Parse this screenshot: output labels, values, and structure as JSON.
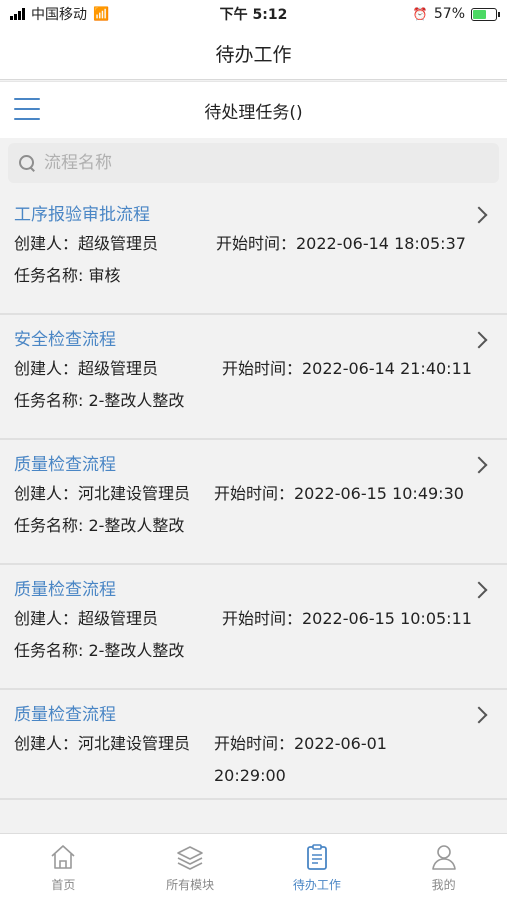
{
  "status_bar": {
    "carrier": "中国移动",
    "time": "下午 5:12",
    "battery": "57%",
    "battery_level": 0.57
  },
  "header": {
    "title": "待办工作"
  },
  "sub_header": {
    "title": "待处理任务()"
  },
  "search": {
    "placeholder": "流程名称",
    "value": ""
  },
  "tasks": [
    {
      "title": "工序报验审批流程",
      "creator": "创建人：超级管理员",
      "start": "开始时间：2022-06-14 18:05:37",
      "task": "任务名称: 审核"
    },
    {
      "title": "安全检查流程",
      "creator": "创建人：超级管理员",
      "start": "开始时间：2022-06-14 21:40:11",
      "task": "任务名称: 2-整改人整改"
    },
    {
      "title": "质量检查流程",
      "creator": "创建人：河北建设管理员",
      "start": "开始时间：2022-06-15 10:49:30",
      "task": "任务名称: 2-整改人整改"
    },
    {
      "title": "质量检查流程",
      "creator": "创建人：超级管理员",
      "start": "开始时间：2022-06-15 10:05:11",
      "task": "任务名称: 2-整改人整改"
    },
    {
      "title": "质量检查流程",
      "creator": "创建人：河北建设管理员",
      "start": "开始时间：2022-06-01 20:29:00",
      "task": ""
    }
  ],
  "tabs": [
    {
      "label": "首页",
      "icon": "home-icon",
      "active": false
    },
    {
      "label": "所有模块",
      "icon": "layers-icon",
      "active": false
    },
    {
      "label": "待办工作",
      "icon": "clipboard-icon",
      "active": true
    },
    {
      "label": "我的",
      "icon": "user-icon",
      "active": false
    }
  ],
  "colors": {
    "accent": "#4a86c5",
    "background": "#f2f2f2"
  }
}
